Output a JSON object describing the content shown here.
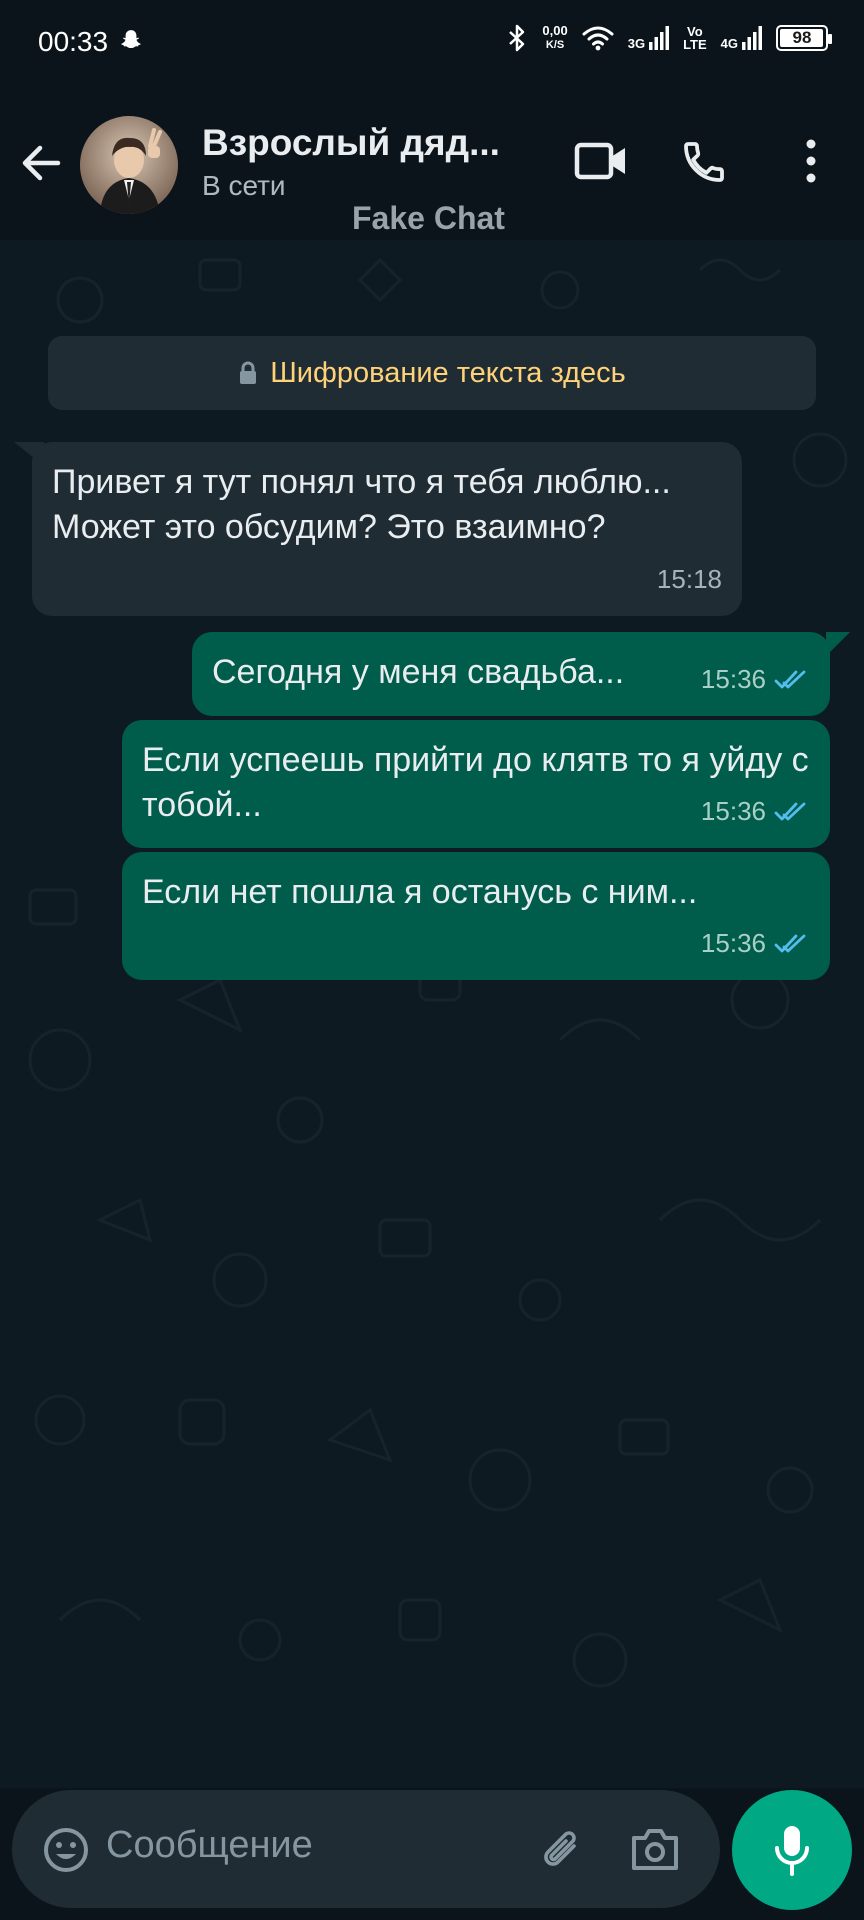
{
  "status_bar": {
    "time": "00:33",
    "net_speed_value": "0,00",
    "net_speed_unit": "K/S",
    "network_1": "3G",
    "network_2_top": "Vo",
    "network_2_bottom": "LTE",
    "network_3": "4G",
    "battery": "98",
    "battery_level": 0.98
  },
  "header": {
    "contact_name": "Взрослый дяд...",
    "contact_status": "В сети",
    "watermark": "Fake Chat"
  },
  "chat": {
    "encryption_notice": "Шифрование текста здесь",
    "messages": [
      {
        "direction": "incoming",
        "text": "Привет я тут понял что я тебя люблю... Может это обсудим? Это взаимно?",
        "time": "15:18"
      },
      {
        "direction": "outgoing",
        "text": "Сегодня у меня свадьба...",
        "time": "15:36",
        "status": "read"
      },
      {
        "direction": "outgoing",
        "text": "Если успеешь прийти до клятв то я уйду с тобой...",
        "time": "15:36",
        "status": "read"
      },
      {
        "direction": "outgoing",
        "text": "Если нет пошла я останусь с ним...",
        "time": "15:36",
        "status": "read"
      }
    ]
  },
  "input": {
    "placeholder": "Сообщение"
  },
  "colors": {
    "background": "#0b141a",
    "incoming_bubble": "#1f2c34",
    "outgoing_bubble": "#005c4b",
    "accent": "#00a884",
    "read_ticks": "#53bdeb",
    "encryption_text": "#ffd279"
  },
  "icons": {
    "back": "arrow-left-icon",
    "video": "video-camera-icon",
    "call": "phone-icon",
    "menu": "more-vertical-icon",
    "lock": "lock-icon",
    "emoji": "emoji-icon",
    "attach": "paperclip-icon",
    "camera": "camera-icon",
    "mic": "microphone-icon"
  }
}
